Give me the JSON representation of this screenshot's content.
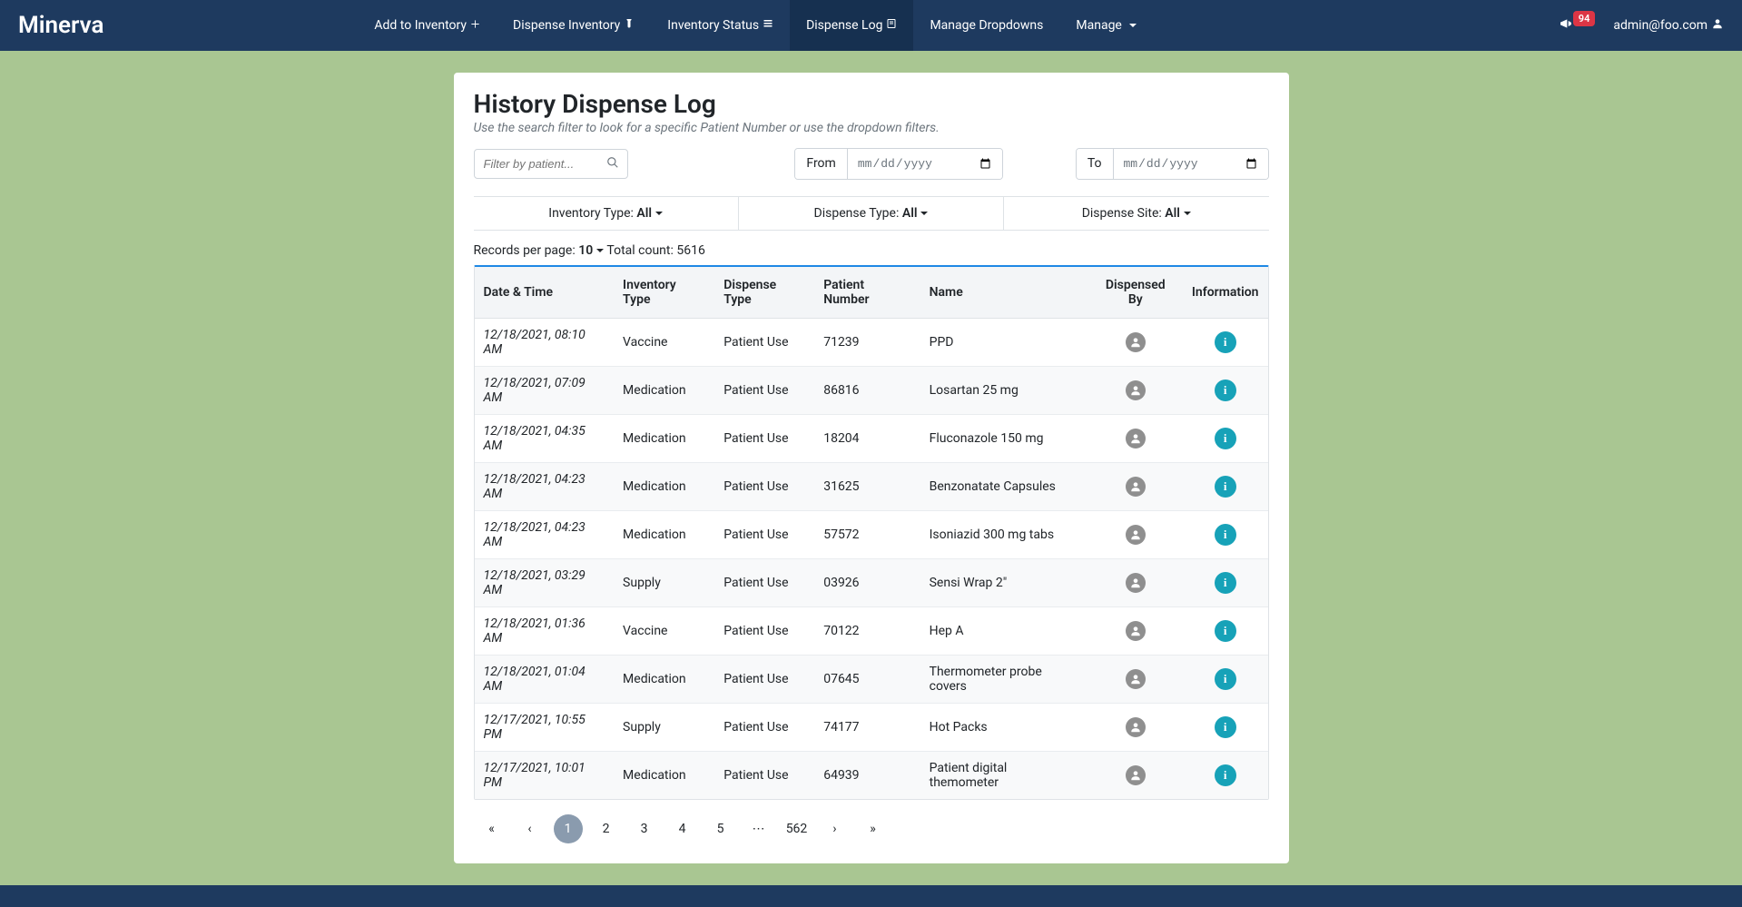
{
  "brand": "Minerva",
  "nav": {
    "items": [
      {
        "label": "Add to Inventory",
        "icon": "plus"
      },
      {
        "label": "Dispense Inventory",
        "icon": "vial"
      },
      {
        "label": "Inventory Status",
        "icon": "list"
      },
      {
        "label": "Dispense Log",
        "icon": "log",
        "active": true
      },
      {
        "label": "Manage Dropdowns",
        "icon": ""
      },
      {
        "label": "Manage",
        "icon": "caret"
      }
    ],
    "notification_count": "94",
    "user_email": "admin@foo.com"
  },
  "page": {
    "title": "History Dispense Log",
    "subtitle": "Use the search filter to look for a specific Patient Number or use the dropdown filters."
  },
  "filters": {
    "search_placeholder": "Filter by patient...",
    "from_label": "From",
    "to_label": "To",
    "date_placeholder": "mm/dd/yyyy",
    "inventory_type": {
      "label": "Inventory Type:",
      "value": "All"
    },
    "dispense_type": {
      "label": "Dispense Type:",
      "value": "All"
    },
    "dispense_site": {
      "label": "Dispense Site:",
      "value": "All"
    }
  },
  "records": {
    "per_page_label": "Records per page:",
    "per_page_value": "10",
    "total_label": "Total count:",
    "total_value": "5616"
  },
  "table": {
    "headers": [
      "Date & Time",
      "Inventory Type",
      "Dispense Type",
      "Patient Number",
      "Name",
      "Dispensed By",
      "Information"
    ],
    "rows": [
      {
        "datetime": "12/18/2021, 08:10 AM",
        "inv_type": "Vaccine",
        "disp_type": "Patient Use",
        "patient": "71239",
        "name": "PPD"
      },
      {
        "datetime": "12/18/2021, 07:09 AM",
        "inv_type": "Medication",
        "disp_type": "Patient Use",
        "patient": "86816",
        "name": "Losartan 25 mg"
      },
      {
        "datetime": "12/18/2021, 04:35 AM",
        "inv_type": "Medication",
        "disp_type": "Patient Use",
        "patient": "18204",
        "name": "Fluconazole 150 mg"
      },
      {
        "datetime": "12/18/2021, 04:23 AM",
        "inv_type": "Medication",
        "disp_type": "Patient Use",
        "patient": "31625",
        "name": "Benzonatate Capsules"
      },
      {
        "datetime": "12/18/2021, 04:23 AM",
        "inv_type": "Medication",
        "disp_type": "Patient Use",
        "patient": "57572",
        "name": "Isoniazid 300 mg tabs"
      },
      {
        "datetime": "12/18/2021, 03:29 AM",
        "inv_type": "Supply",
        "disp_type": "Patient Use",
        "patient": "03926",
        "name": "Sensi Wrap 2\""
      },
      {
        "datetime": "12/18/2021, 01:36 AM",
        "inv_type": "Vaccine",
        "disp_type": "Patient Use",
        "patient": "70122",
        "name": "Hep A"
      },
      {
        "datetime": "12/18/2021, 01:04 AM",
        "inv_type": "Medication",
        "disp_type": "Patient Use",
        "patient": "07645",
        "name": "Thermometer probe covers"
      },
      {
        "datetime": "12/17/2021, 10:55 PM",
        "inv_type": "Supply",
        "disp_type": "Patient Use",
        "patient": "74177",
        "name": "Hot Packs"
      },
      {
        "datetime": "12/17/2021, 10:01 PM",
        "inv_type": "Medication",
        "disp_type": "Patient Use",
        "patient": "64939",
        "name": "Patient digital themometer"
      }
    ]
  },
  "pagination": {
    "pages": [
      "1",
      "2",
      "3",
      "4",
      "5"
    ],
    "ellipsis": "⋯",
    "last_page": "562",
    "active": "1"
  }
}
